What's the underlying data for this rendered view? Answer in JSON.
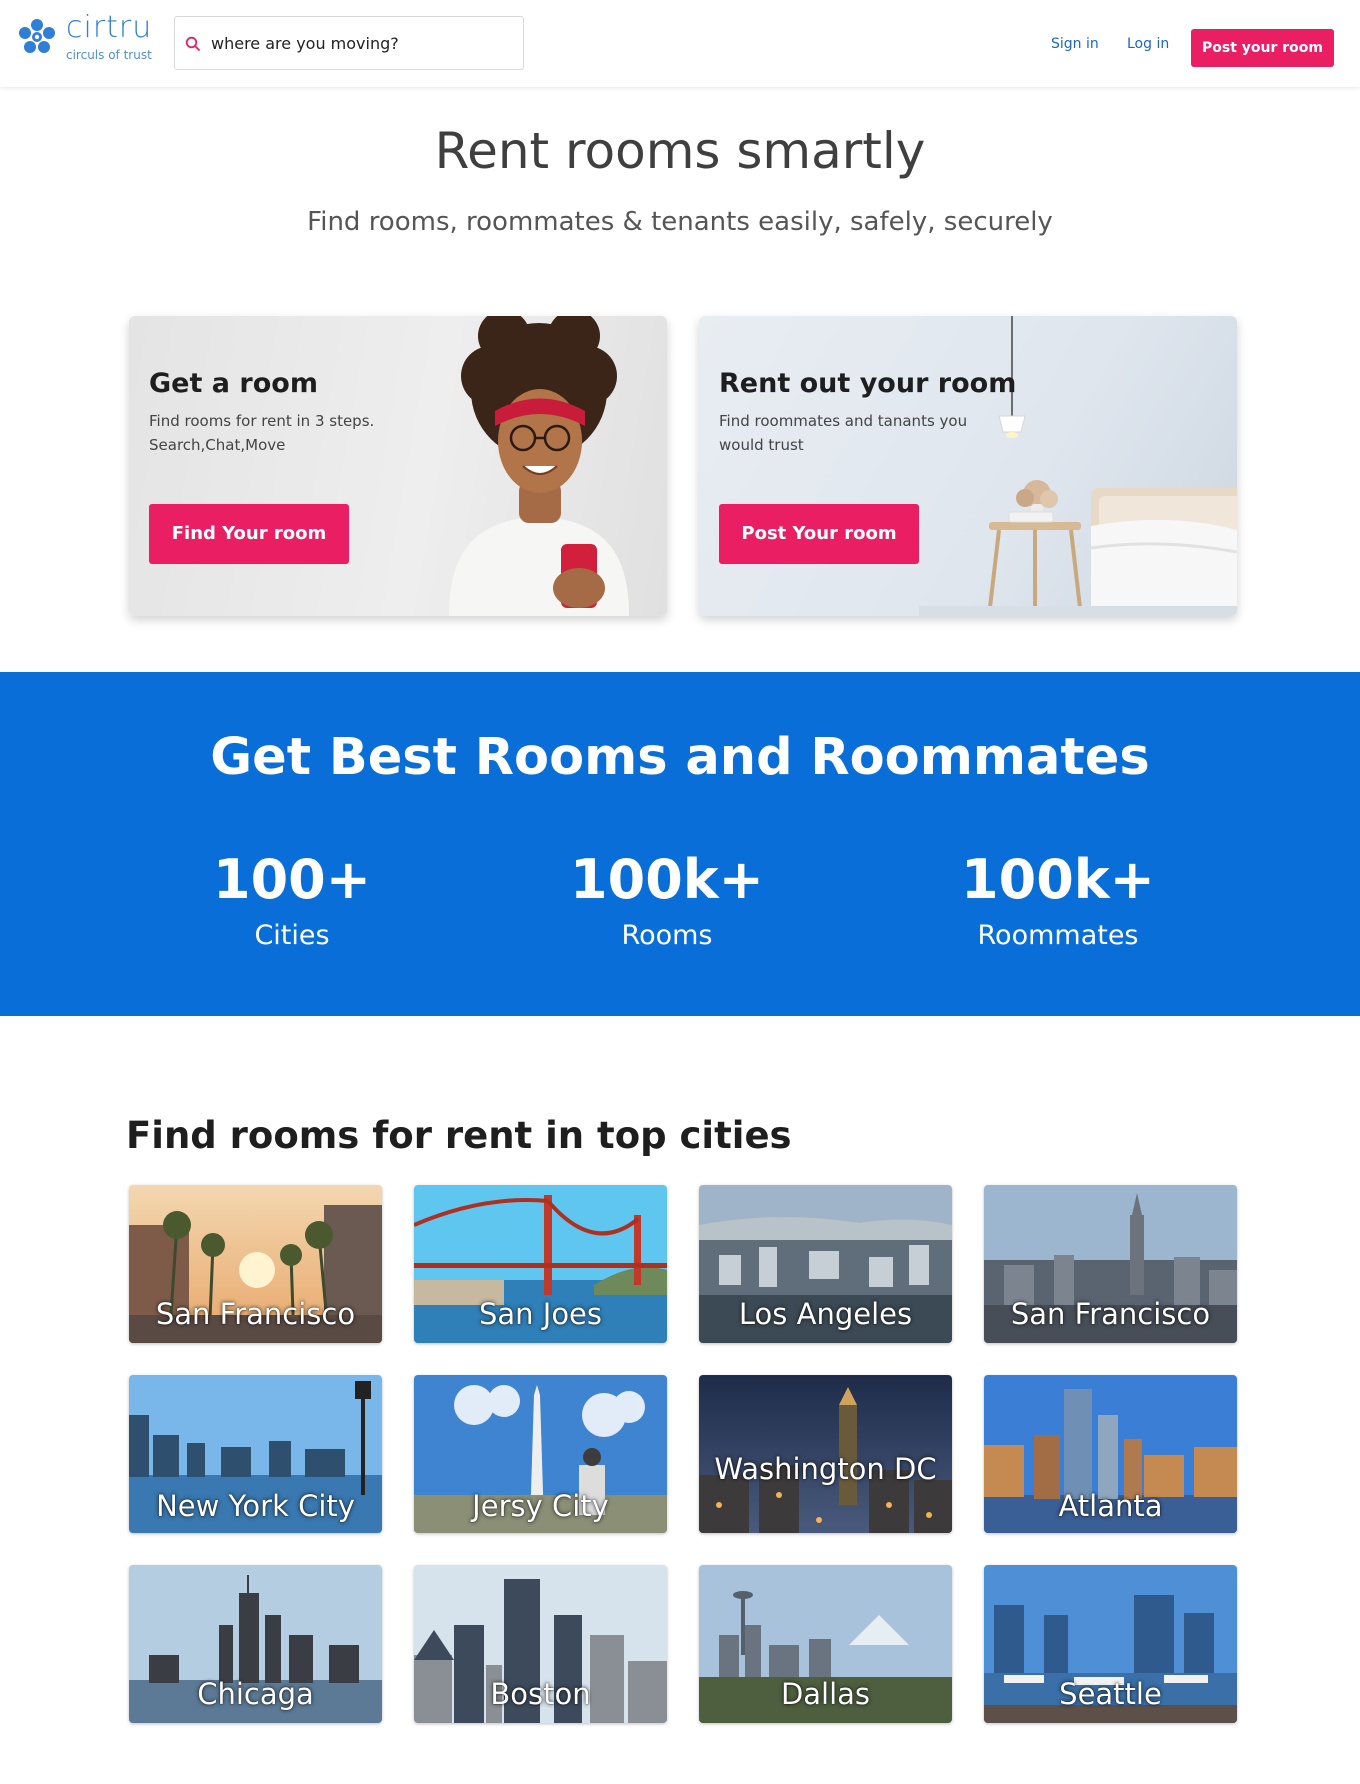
{
  "header": {
    "logo_name": "cirtru",
    "logo_tagline": "circuls of trust",
    "search_placeholder": "where are you moving?",
    "sign_in": "Sign in",
    "log_in": "Log in",
    "post_room": "Post your room"
  },
  "hero": {
    "title": "Rent rooms smartly",
    "subtitle": "Find rooms, roommates & tenants easily, safely, securely"
  },
  "cards": {
    "get": {
      "title": "Get a room",
      "text": "Find rooms for rent in 3 steps. Search,Chat,Move",
      "button": "Find Your room"
    },
    "rent": {
      "title": "Rent out your room",
      "text": "Find roommates and tanants you would trust",
      "button": "Post Your room"
    }
  },
  "stats": {
    "title": "Get Best Rooms and Roommates",
    "items": [
      {
        "value": "100+",
        "label": "Cities"
      },
      {
        "value": "100k+",
        "label": "Rooms"
      },
      {
        "value": "100k+",
        "label": "Roommates"
      }
    ]
  },
  "cities": {
    "title": "Find rooms for rent in top cities",
    "items": [
      {
        "name": "San Francisco"
      },
      {
        "name": "San Joes"
      },
      {
        "name": "Los Angeles"
      },
      {
        "name": "San Francisco"
      },
      {
        "name": "New York City"
      },
      {
        "name": "Jersy City"
      },
      {
        "name": "Washington DC"
      },
      {
        "name": "Atlanta"
      },
      {
        "name": "Chicaga"
      },
      {
        "name": "Boston"
      },
      {
        "name": "Dallas"
      },
      {
        "name": "Seattle"
      }
    ]
  },
  "colors": {
    "accent": "#e91e63",
    "brand_blue": "#0a6ed9",
    "link_blue": "#1a66c8"
  }
}
